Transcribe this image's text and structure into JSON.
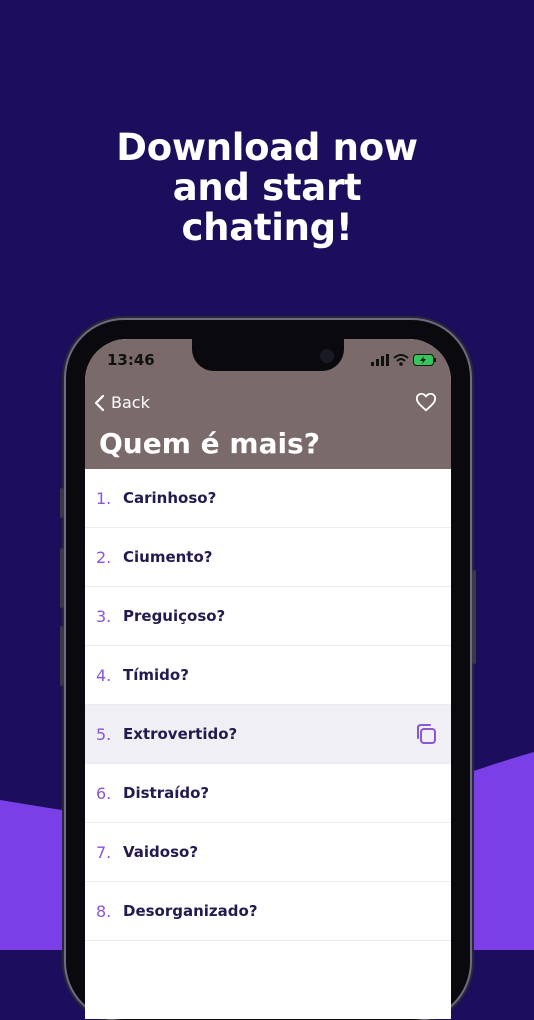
{
  "promo": {
    "line1": "Download now",
    "line2": "and start",
    "line3": "chating!"
  },
  "status": {
    "time": "13:46"
  },
  "nav": {
    "back_label": "Back",
    "title": "Quem é mais?"
  },
  "items": [
    {
      "num": "1.",
      "label": "Carinhoso?"
    },
    {
      "num": "2.",
      "label": "Ciumento?"
    },
    {
      "num": "3.",
      "label": "Preguiçoso?"
    },
    {
      "num": "4.",
      "label": "Tímido?"
    },
    {
      "num": "5.",
      "label": "Extrovertido?"
    },
    {
      "num": "6.",
      "label": "Distraído?"
    },
    {
      "num": "7.",
      "label": "Vaidoso?"
    },
    {
      "num": "8.",
      "label": "Desorganizado?"
    }
  ],
  "colors": {
    "background": "#1c0e5c",
    "wave": "#7b3fe8",
    "header": "#7a6a6a",
    "number": "#8a55d6",
    "text": "#241a4e"
  }
}
